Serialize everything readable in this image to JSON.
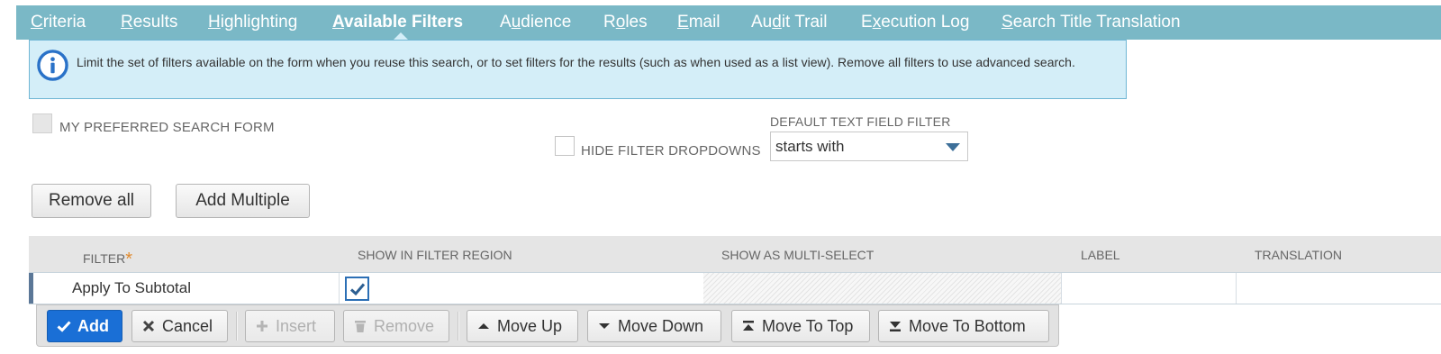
{
  "tabs": [
    {
      "pre": "",
      "acc": "C",
      "post": "riteria",
      "active": false
    },
    {
      "pre": "",
      "acc": "R",
      "post": "esults",
      "active": false
    },
    {
      "pre": "",
      "acc": "H",
      "post": "ighlighting",
      "active": false
    },
    {
      "pre": "",
      "acc": "A",
      "post": "vailable Filters",
      "active": true
    },
    {
      "pre": "A",
      "acc": "u",
      "post": "dience",
      "active": false
    },
    {
      "pre": "R",
      "acc": "o",
      "post": "les",
      "active": false
    },
    {
      "pre": "",
      "acc": "E",
      "post": "mail",
      "active": false
    },
    {
      "pre": "Au",
      "acc": "d",
      "post": "it Trail",
      "active": false
    },
    {
      "pre": "E",
      "acc": "x",
      "post": "ecution Log",
      "active": false
    },
    {
      "pre": "",
      "acc": "S",
      "post": "earch Title Translation",
      "active": false
    }
  ],
  "info": {
    "icon": "info-icon",
    "text": "Limit the set of filters available on the form when you reuse this search, or to set filters for the results (such as when used as a list view). Remove all filters to use advanced search."
  },
  "options": {
    "preferred_form_label": "MY PREFERRED SEARCH FORM",
    "preferred_form_checked": false,
    "hide_dropdowns_label": "HIDE FILTER DROPDOWNS",
    "hide_dropdowns_checked": false,
    "default_filter_label": "DEFAULT TEXT FIELD FILTER",
    "default_filter_value": "starts with"
  },
  "buttons": {
    "remove_all": "Remove all",
    "add_multiple": "Add Multiple"
  },
  "table": {
    "columns": [
      "FILTER",
      "SHOW IN FILTER REGION",
      "SHOW AS MULTI-SELECT",
      "LABEL",
      "TRANSLATION"
    ],
    "required_marker": "*",
    "rows": [
      {
        "filter": "Apply To Subtotal",
        "show_in_filter_region": true,
        "show_as_multi_select": null,
        "label": "",
        "translation": ""
      }
    ]
  },
  "toolbar": {
    "add": "Add",
    "cancel": "Cancel",
    "insert": "Insert",
    "remove": "Remove",
    "move_up": "Move Up",
    "move_down": "Move Down",
    "move_to_top": "Move To Top",
    "move_to_bottom": "Move To Bottom"
  },
  "colors": {
    "tab_bar": "#7ab8c6",
    "info_bg": "#d4eef8",
    "primary_button": "#1a6fd6",
    "required_star": "#e08a2e"
  }
}
